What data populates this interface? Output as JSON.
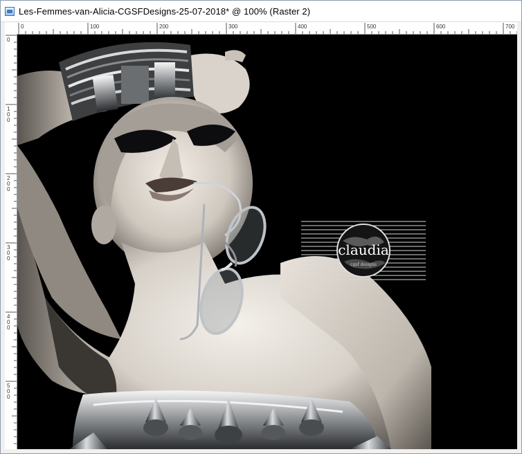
{
  "window": {
    "title": "Les-Femmes-van-Alicia-CGSFDesigns-25-07-2018* @ 100% (Raster 2)",
    "app_icon": "raster-document-icon"
  },
  "rulers": {
    "unit": "px",
    "horizontal_labels": [
      "0",
      "100",
      "200",
      "300",
      "400",
      "500",
      "600",
      "700"
    ],
    "vertical_labels": [
      "0",
      "100",
      "200",
      "300",
      "400",
      "500"
    ]
  },
  "canvas": {
    "background": "#000000",
    "layer": "Raster 2",
    "zoom": "100%"
  },
  "watermark": {
    "text": "claudia",
    "subtext": "cgsf designs"
  }
}
